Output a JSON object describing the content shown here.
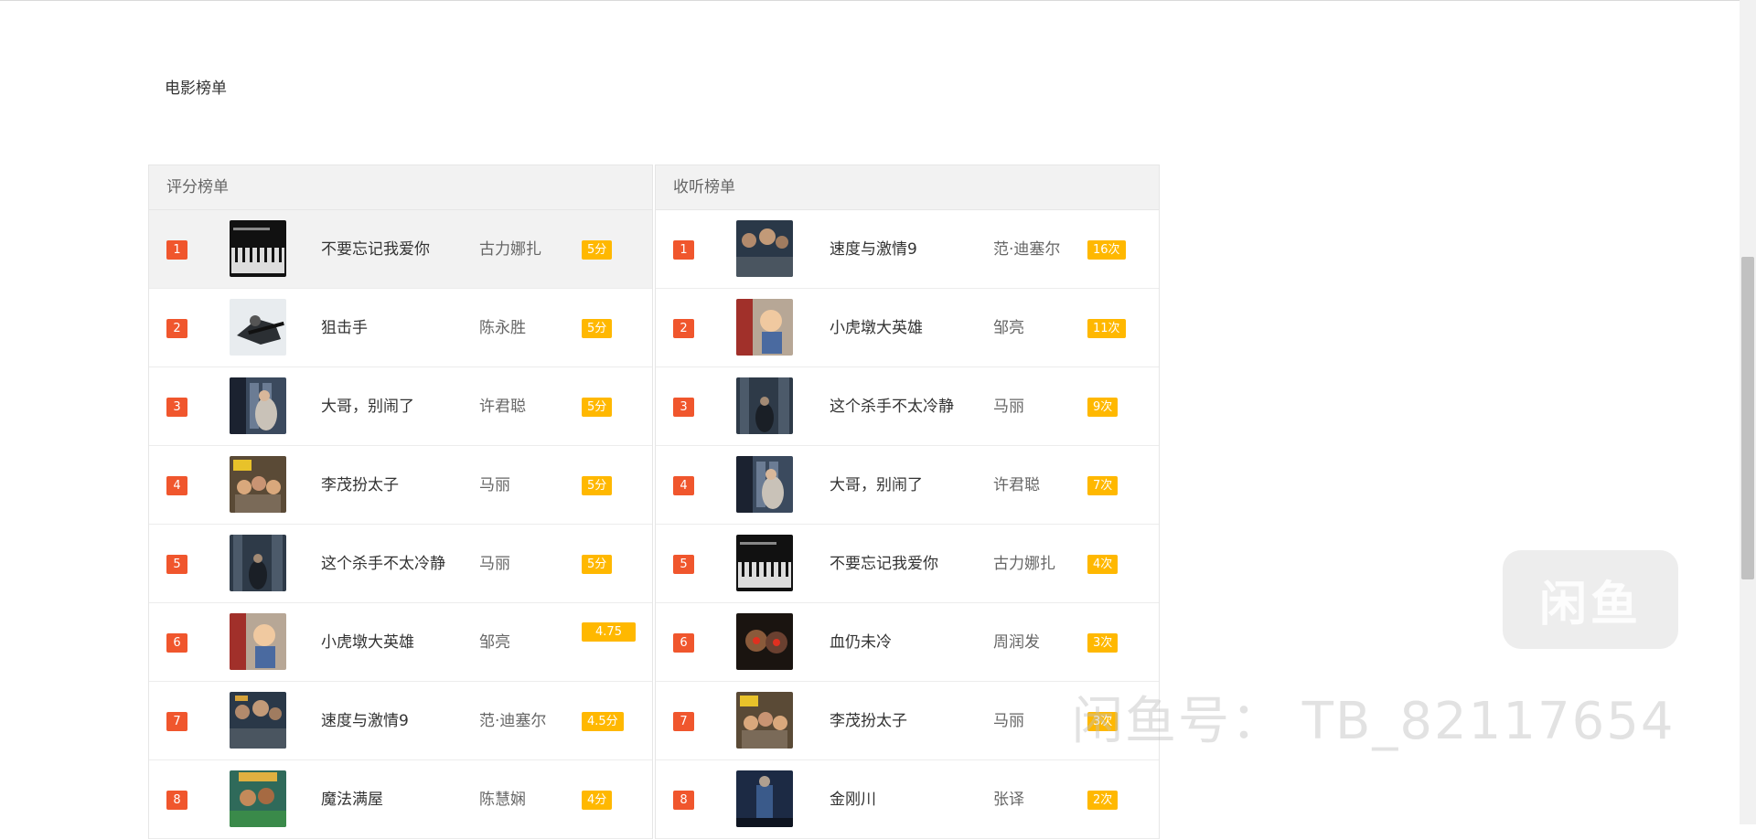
{
  "page": {
    "title": "电影榜单"
  },
  "colors": {
    "rank_badge": "#f0562d",
    "score_badge": "#ffb800",
    "header_bg": "#f2f2f2"
  },
  "rating_board": {
    "title": "评分榜单",
    "rows": [
      {
        "rank": "1",
        "name": "不要忘记我爱你",
        "person": "古力娜扎",
        "badge": "5分"
      },
      {
        "rank": "2",
        "name": "狙击手",
        "person": "陈永胜",
        "badge": "5分"
      },
      {
        "rank": "3",
        "name": "大哥，别闹了",
        "person": "许君聪",
        "badge": "5分"
      },
      {
        "rank": "4",
        "name": "李茂扮太子",
        "person": "马丽",
        "badge": "5分"
      },
      {
        "rank": "5",
        "name": "这个杀手不太冷静",
        "person": "马丽",
        "badge": "5分"
      },
      {
        "rank": "6",
        "name": "小虎墩大英雄",
        "person": "邹亮",
        "badge": "4.75"
      },
      {
        "rank": "7",
        "name": "速度与激情9",
        "person": "范·迪塞尔",
        "badge": "4.5分"
      },
      {
        "rank": "8",
        "name": "魔法满屋",
        "person": "陈慧娴",
        "badge": "4分"
      }
    ]
  },
  "listen_board": {
    "title": "收听榜单",
    "rows": [
      {
        "rank": "1",
        "name": "速度与激情9",
        "person": "范·迪塞尔",
        "badge": "16次"
      },
      {
        "rank": "2",
        "name": "小虎墩大英雄",
        "person": "邹亮",
        "badge": "11次"
      },
      {
        "rank": "3",
        "name": "这个杀手不太冷静",
        "person": "马丽",
        "badge": "9次"
      },
      {
        "rank": "4",
        "name": "大哥，别闹了",
        "person": "许君聪",
        "badge": "7次"
      },
      {
        "rank": "5",
        "name": "不要忘记我爱你",
        "person": "古力娜扎",
        "badge": "4次"
      },
      {
        "rank": "6",
        "name": "血仍未冷",
        "person": "周润发",
        "badge": "3次"
      },
      {
        "rank": "7",
        "name": "李茂扮太子",
        "person": "马丽",
        "badge": "3次"
      },
      {
        "rank": "8",
        "name": "金刚川",
        "person": "张译",
        "badge": "2次"
      }
    ]
  },
  "watermark": {
    "logo": "闲鱼",
    "text": "闲鱼号： TB_82117654"
  }
}
